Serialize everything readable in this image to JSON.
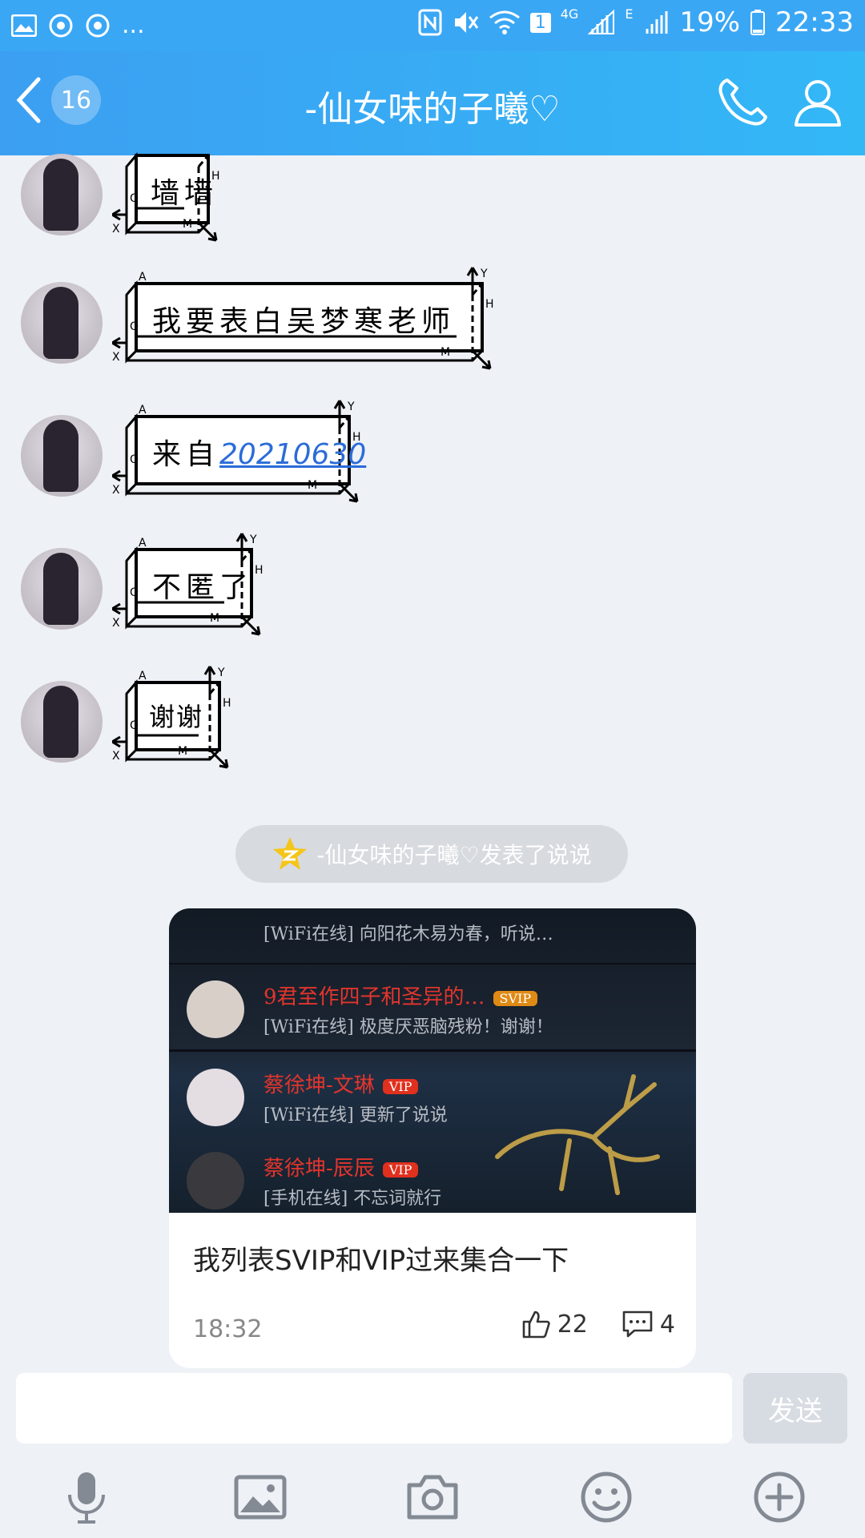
{
  "status_bar": {
    "more": "...",
    "network_4g": "4G",
    "network_e": "E",
    "sim": "1",
    "battery": "19%",
    "time": "22:33"
  },
  "header": {
    "unread_count": "16",
    "title": "-仙女味的子曦♡"
  },
  "messages": [
    {
      "text": "墙墙"
    },
    {
      "text": "我要表白吴梦寒老师"
    },
    {
      "prefix": "来自",
      "link": "20210630"
    },
    {
      "text": "不匿了"
    },
    {
      "text": "谢谢"
    }
  ],
  "bubble_labels": {
    "a": "A",
    "h": "H",
    "o": "O",
    "x": "X",
    "m": "M",
    "y": "Y"
  },
  "notice": {
    "text": "-仙女味的子曦♡发表了说说"
  },
  "post": {
    "caption": "我列表SVIP和VIP过来集合一下",
    "time": "18:32",
    "likes": "22",
    "comments": "4",
    "image_rows": [
      {
        "name": "9君至作四子和圣异的…",
        "tag": "SVIP",
        "sig": "[WiFi在线] 极度厌恶脑残粉！谢谢！"
      },
      {
        "name": "蔡徐坤-文琳",
        "tag": "VIP",
        "sig": "[WiFi在线] 更新了说说"
      },
      {
        "name": "蔡徐坤-辰辰",
        "tag": "VIP",
        "sig": "[手机在线] 不忘词就行"
      }
    ],
    "image_top_sig": "[WiFi在线] 向阳花木易为春，听说…"
  },
  "composer": {
    "send_label": "发送"
  },
  "toolbar": [
    "microphone-icon",
    "image-icon",
    "camera-icon",
    "emoji-icon",
    "plus-icon"
  ],
  "colors": {
    "header": "#3aa7f5",
    "link": "#2b6cd8",
    "send_disabled": "#d7dbe2",
    "background": "#eef1f6"
  }
}
